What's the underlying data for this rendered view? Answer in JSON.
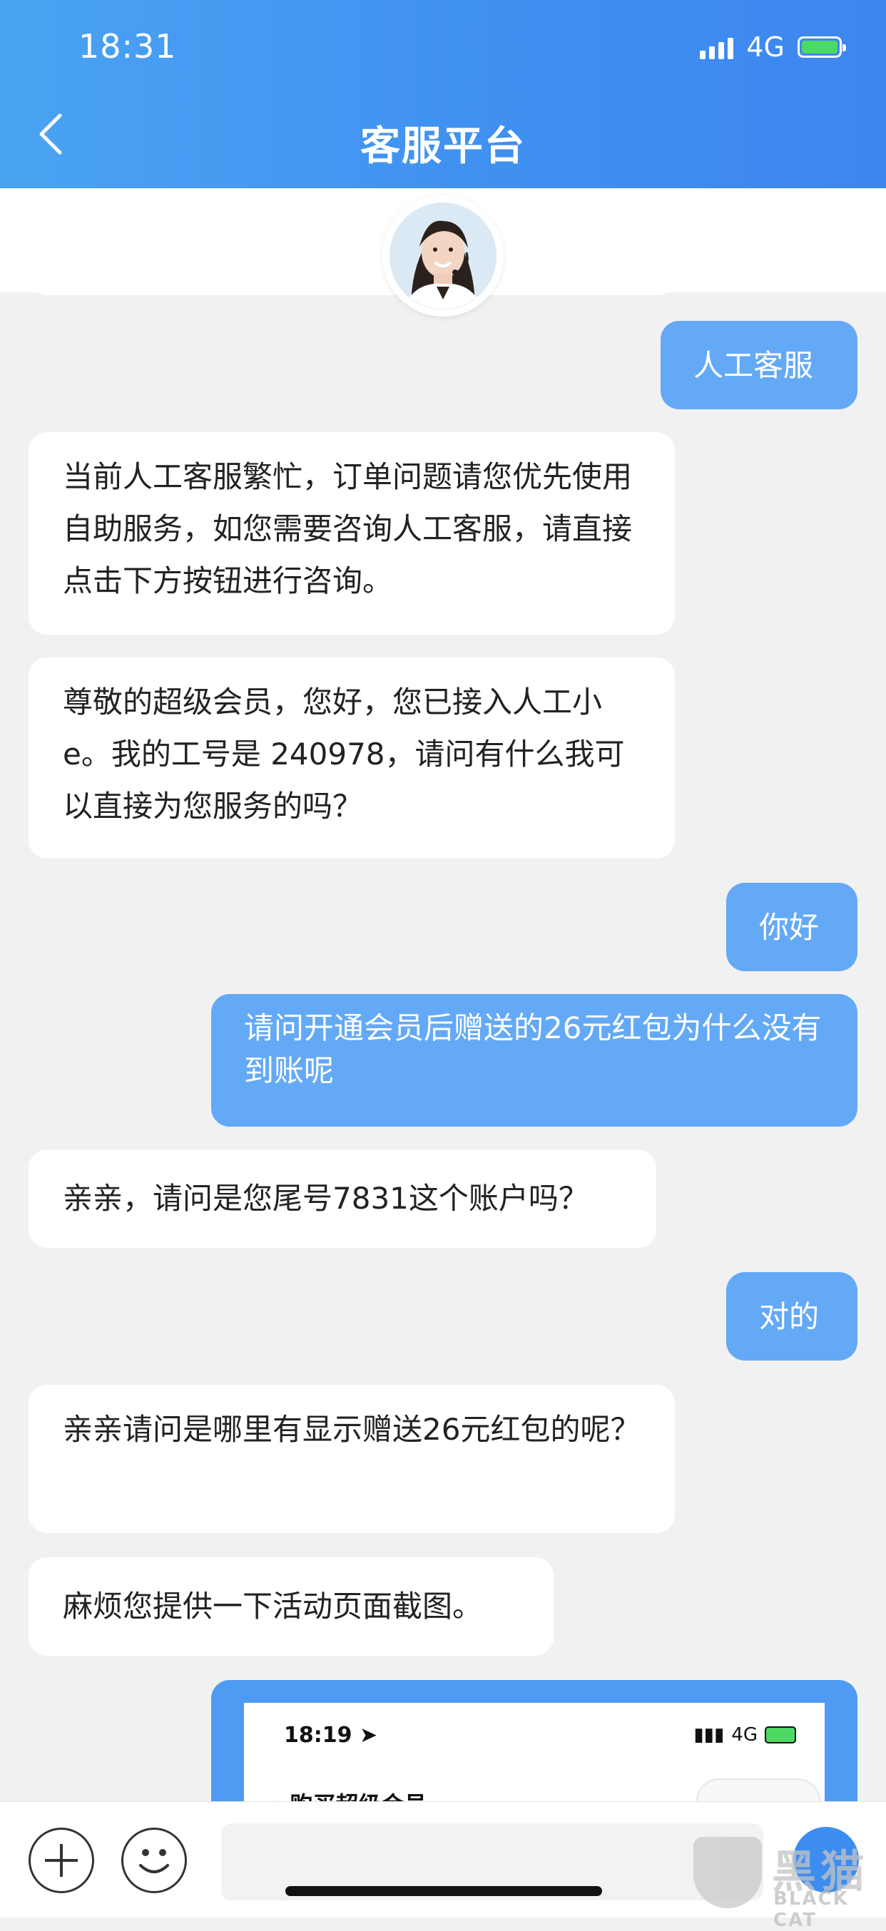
{
  "status_bar": {
    "time": "18:31",
    "network": "4G"
  },
  "header": {
    "title": "客服平台"
  },
  "messages": [
    {
      "side": "right",
      "text": "人工客服"
    },
    {
      "side": "left",
      "text": "当前人工客服繁忙，订单问题请您优先使用自助服务，如您需要咨询人工客服，请直接点击下方按钮进行咨询。"
    },
    {
      "side": "left",
      "text": "尊敬的超级会员，您好，您已接入人工小e。我的工号是 240978，请问有什么我可以直接为您服务的吗？"
    },
    {
      "side": "right",
      "text": "你好"
    },
    {
      "side": "right",
      "text": "请问开通会员后赠送的26元红包为什么没有到账呢"
    },
    {
      "side": "left",
      "text": "亲亲，请问是您尾号7831这个账户吗？"
    },
    {
      "side": "right",
      "text": "对的"
    },
    {
      "side": "left",
      "text": "亲亲请问是哪里有显示赠送26元红包的呢？"
    },
    {
      "side": "left",
      "text": "麻烦您提供一下活动页面截图。"
    }
  ],
  "shared_screenshot": {
    "time": "18:19",
    "network": "4G",
    "page_title": "购买超级会员"
  },
  "watermark": {
    "text_cn": "黑猫",
    "text_en": "BLACK CAT"
  },
  "colors": {
    "header": "#3f8ff0",
    "user_bubble": "#64a9f6",
    "agent_bubble": "#ffffff",
    "background": "#f1f1f1"
  }
}
